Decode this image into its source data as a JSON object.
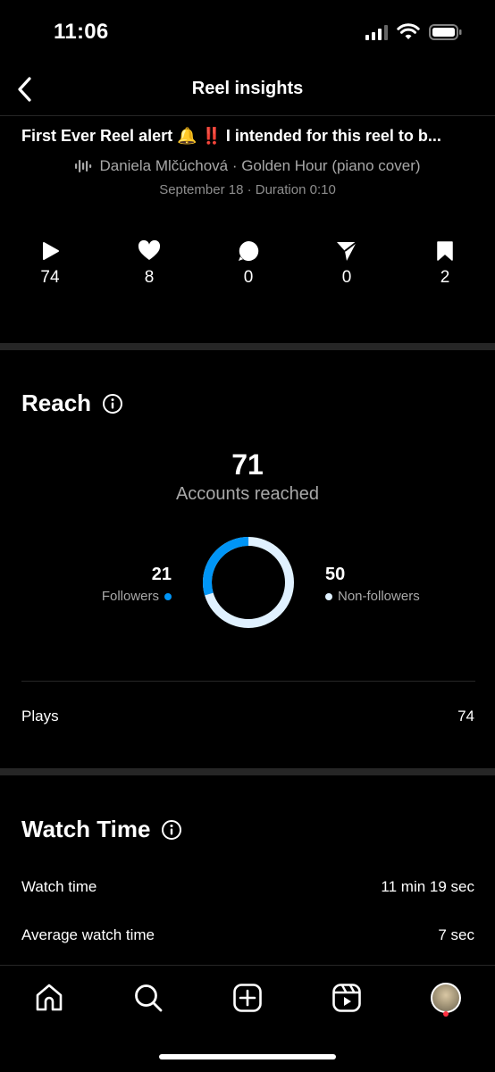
{
  "status_bar": {
    "time": "11:06"
  },
  "header": {
    "title": "Reel insights",
    "back_icon": "chevron-left-icon"
  },
  "reel": {
    "caption": "First Ever Reel alert 🔔 ‼️ I intended for this reel to b...",
    "audio": "Daniela Mlčúchová · Golden Hour (piano cover)",
    "meta": "September 18 · Duration 0:10"
  },
  "stats": [
    {
      "icon": "play-icon",
      "value": "74"
    },
    {
      "icon": "heart-icon",
      "value": "8"
    },
    {
      "icon": "comment-icon",
      "value": "0"
    },
    {
      "icon": "share-icon",
      "value": "0"
    },
    {
      "icon": "bookmark-icon",
      "value": "2"
    }
  ],
  "reach": {
    "title": "Reach",
    "accounts_reached": "71",
    "accounts_reached_label": "Accounts reached",
    "followers": {
      "value": "21",
      "label": "Followers",
      "color": "#0095f6"
    },
    "non_followers": {
      "value": "50",
      "label": "Non-followers",
      "color": "#e0f1ff"
    },
    "plays_label": "Plays",
    "plays_value": "74"
  },
  "watch_time": {
    "title": "Watch Time",
    "total_label": "Watch time",
    "total_value": "11 min 19 sec",
    "avg_label": "Average watch time",
    "avg_value": "7 sec"
  },
  "nav": [
    "home-icon",
    "search-icon",
    "create-icon",
    "reels-icon",
    "profile-avatar"
  ]
}
